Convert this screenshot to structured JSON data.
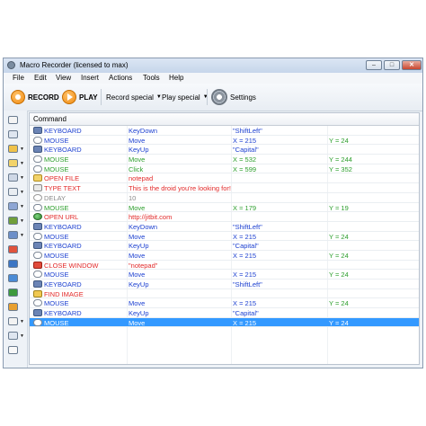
{
  "window": {
    "title": "Macro Recorder (licensed to max)",
    "buttons": {
      "minimize": "–",
      "maximize": "□",
      "close": "✕"
    }
  },
  "menu": [
    "File",
    "Edit",
    "View",
    "Insert",
    "Actions",
    "Tools",
    "Help"
  ],
  "toolbar": {
    "record_label": "RECORD",
    "play_label": "PLAY",
    "record_special_label": "Record special",
    "play_special_label": "Play special",
    "settings_label": "Settings"
  },
  "grid": {
    "header": "Command",
    "rows": [
      {
        "icon": "keyboard-icon",
        "type": "KEYBOARD",
        "action": "KeyDown",
        "p1": "\"ShiftLeft\"",
        "p2": "",
        "type_color": "blue",
        "action_color": "blue",
        "p1_color": "blue",
        "p2_color": "green"
      },
      {
        "icon": "mouse-icon",
        "type": "MOUSE",
        "action": "Move",
        "p1": "X = 215",
        "p2": "Y = 24",
        "type_color": "blue",
        "action_color": "blue",
        "p1_color": "blue",
        "p2_color": "green"
      },
      {
        "icon": "keyboard-icon",
        "type": "KEYBOARD",
        "action": "KeyUp",
        "p1": "\"Capital\"",
        "p2": "",
        "type_color": "blue",
        "action_color": "blue",
        "p1_color": "blue",
        "p2_color": "green"
      },
      {
        "icon": "mouse-icon",
        "type": "MOUSE",
        "action": "Move",
        "p1": "X = 532",
        "p2": "Y = 244",
        "type_color": "green",
        "action_color": "green",
        "p1_color": "green",
        "p2_color": "green"
      },
      {
        "icon": "mouse-icon",
        "type": "MOUSE",
        "action": "Click",
        "p1": "X = 599",
        "p2": "Y = 352",
        "type_color": "green",
        "action_color": "green",
        "p1_color": "green",
        "p2_color": "green"
      },
      {
        "icon": "file-icon",
        "type": "OPEN FILE",
        "action": "notepad",
        "p1": "",
        "p2": "",
        "type_color": "red",
        "action_color": "red",
        "p1_color": "red",
        "p2_color": "red"
      },
      {
        "icon": "text-icon",
        "type": "TYPE TEXT",
        "action": "This is the droid you're looking for!",
        "p1": "",
        "p2": "",
        "type_color": "red",
        "action_color": "red",
        "p1_color": "red",
        "p2_color": "red"
      },
      {
        "icon": "delay-icon",
        "type": "DELAY",
        "action": "10",
        "p1": "",
        "p2": "",
        "type_color": "gray",
        "action_color": "gray",
        "p1_color": "gray",
        "p2_color": "gray"
      },
      {
        "icon": "mouse-icon",
        "type": "MOUSE",
        "action": "Move",
        "p1": "X = 179",
        "p2": "Y = 19",
        "type_color": "green",
        "action_color": "green",
        "p1_color": "green",
        "p2_color": "green"
      },
      {
        "icon": "globe-icon",
        "type": "OPEN URL",
        "action": "http://jitbit.com",
        "p1": "",
        "p2": "",
        "type_color": "red",
        "action_color": "red",
        "p1_color": "red",
        "p2_color": "red"
      },
      {
        "icon": "keyboard-icon",
        "type": "KEYBOARD",
        "action": "KeyDown",
        "p1": "\"ShiftLeft\"",
        "p2": "",
        "type_color": "blue",
        "action_color": "blue",
        "p1_color": "blue",
        "p2_color": "green"
      },
      {
        "icon": "mouse-icon",
        "type": "MOUSE",
        "action": "Move",
        "p1": "X = 215",
        "p2": "Y = 24",
        "type_color": "blue",
        "action_color": "blue",
        "p1_color": "blue",
        "p2_color": "green"
      },
      {
        "icon": "keyboard-icon",
        "type": "KEYBOARD",
        "action": "KeyUp",
        "p1": "\"Capital\"",
        "p2": "",
        "type_color": "blue",
        "action_color": "blue",
        "p1_color": "blue",
        "p2_color": "green"
      },
      {
        "icon": "mouse-icon",
        "type": "MOUSE",
        "action": "Move",
        "p1": "X = 215",
        "p2": "Y = 24",
        "type_color": "blue",
        "action_color": "blue",
        "p1_color": "blue",
        "p2_color": "green"
      },
      {
        "icon": "close-window-icon",
        "type": "CLOSE WINDOW",
        "action": "\"notepad\"",
        "p1": "",
        "p2": "",
        "type_color": "red",
        "action_color": "red",
        "p1_color": "red",
        "p2_color": "red"
      },
      {
        "icon": "mouse-icon",
        "type": "MOUSE",
        "action": "Move",
        "p1": "X = 215",
        "p2": "Y = 24",
        "type_color": "blue",
        "action_color": "blue",
        "p1_color": "blue",
        "p2_color": "green"
      },
      {
        "icon": "keyboard-icon",
        "type": "KEYBOARD",
        "action": "KeyUp",
        "p1": "\"ShiftLeft\"",
        "p2": "",
        "type_color": "blue",
        "action_color": "blue",
        "p1_color": "blue",
        "p2_color": "green"
      },
      {
        "icon": "image-icon",
        "type": "FIND IMAGE",
        "action": "",
        "p1": "",
        "p2": "",
        "type_color": "red",
        "action_color": "red",
        "p1_color": "red",
        "p2_color": "red"
      },
      {
        "icon": "mouse-icon",
        "type": "MOUSE",
        "action": "Move",
        "p1": "X = 215",
        "p2": "Y = 24",
        "type_color": "blue",
        "action_color": "blue",
        "p1_color": "blue",
        "p2_color": "green"
      },
      {
        "icon": "keyboard-icon",
        "type": "KEYBOARD",
        "action": "KeyUp",
        "p1": "\"Capital\"",
        "p2": "",
        "type_color": "blue",
        "action_color": "blue",
        "p1_color": "blue",
        "p2_color": "green"
      },
      {
        "icon": "mouse-icon",
        "type": "MOUSE",
        "action": "Move",
        "p1": "X = 215",
        "p2": "Y = 24",
        "type_color": "blue",
        "action_color": "blue",
        "p1_color": "blue",
        "p2_color": "green",
        "selected": true
      }
    ]
  },
  "colors": {
    "blue": "#1b3fd0",
    "green": "#2c9e2c",
    "red": "#e22a2a",
    "gray": "#8a8a8a",
    "selection": "#3399ff"
  }
}
